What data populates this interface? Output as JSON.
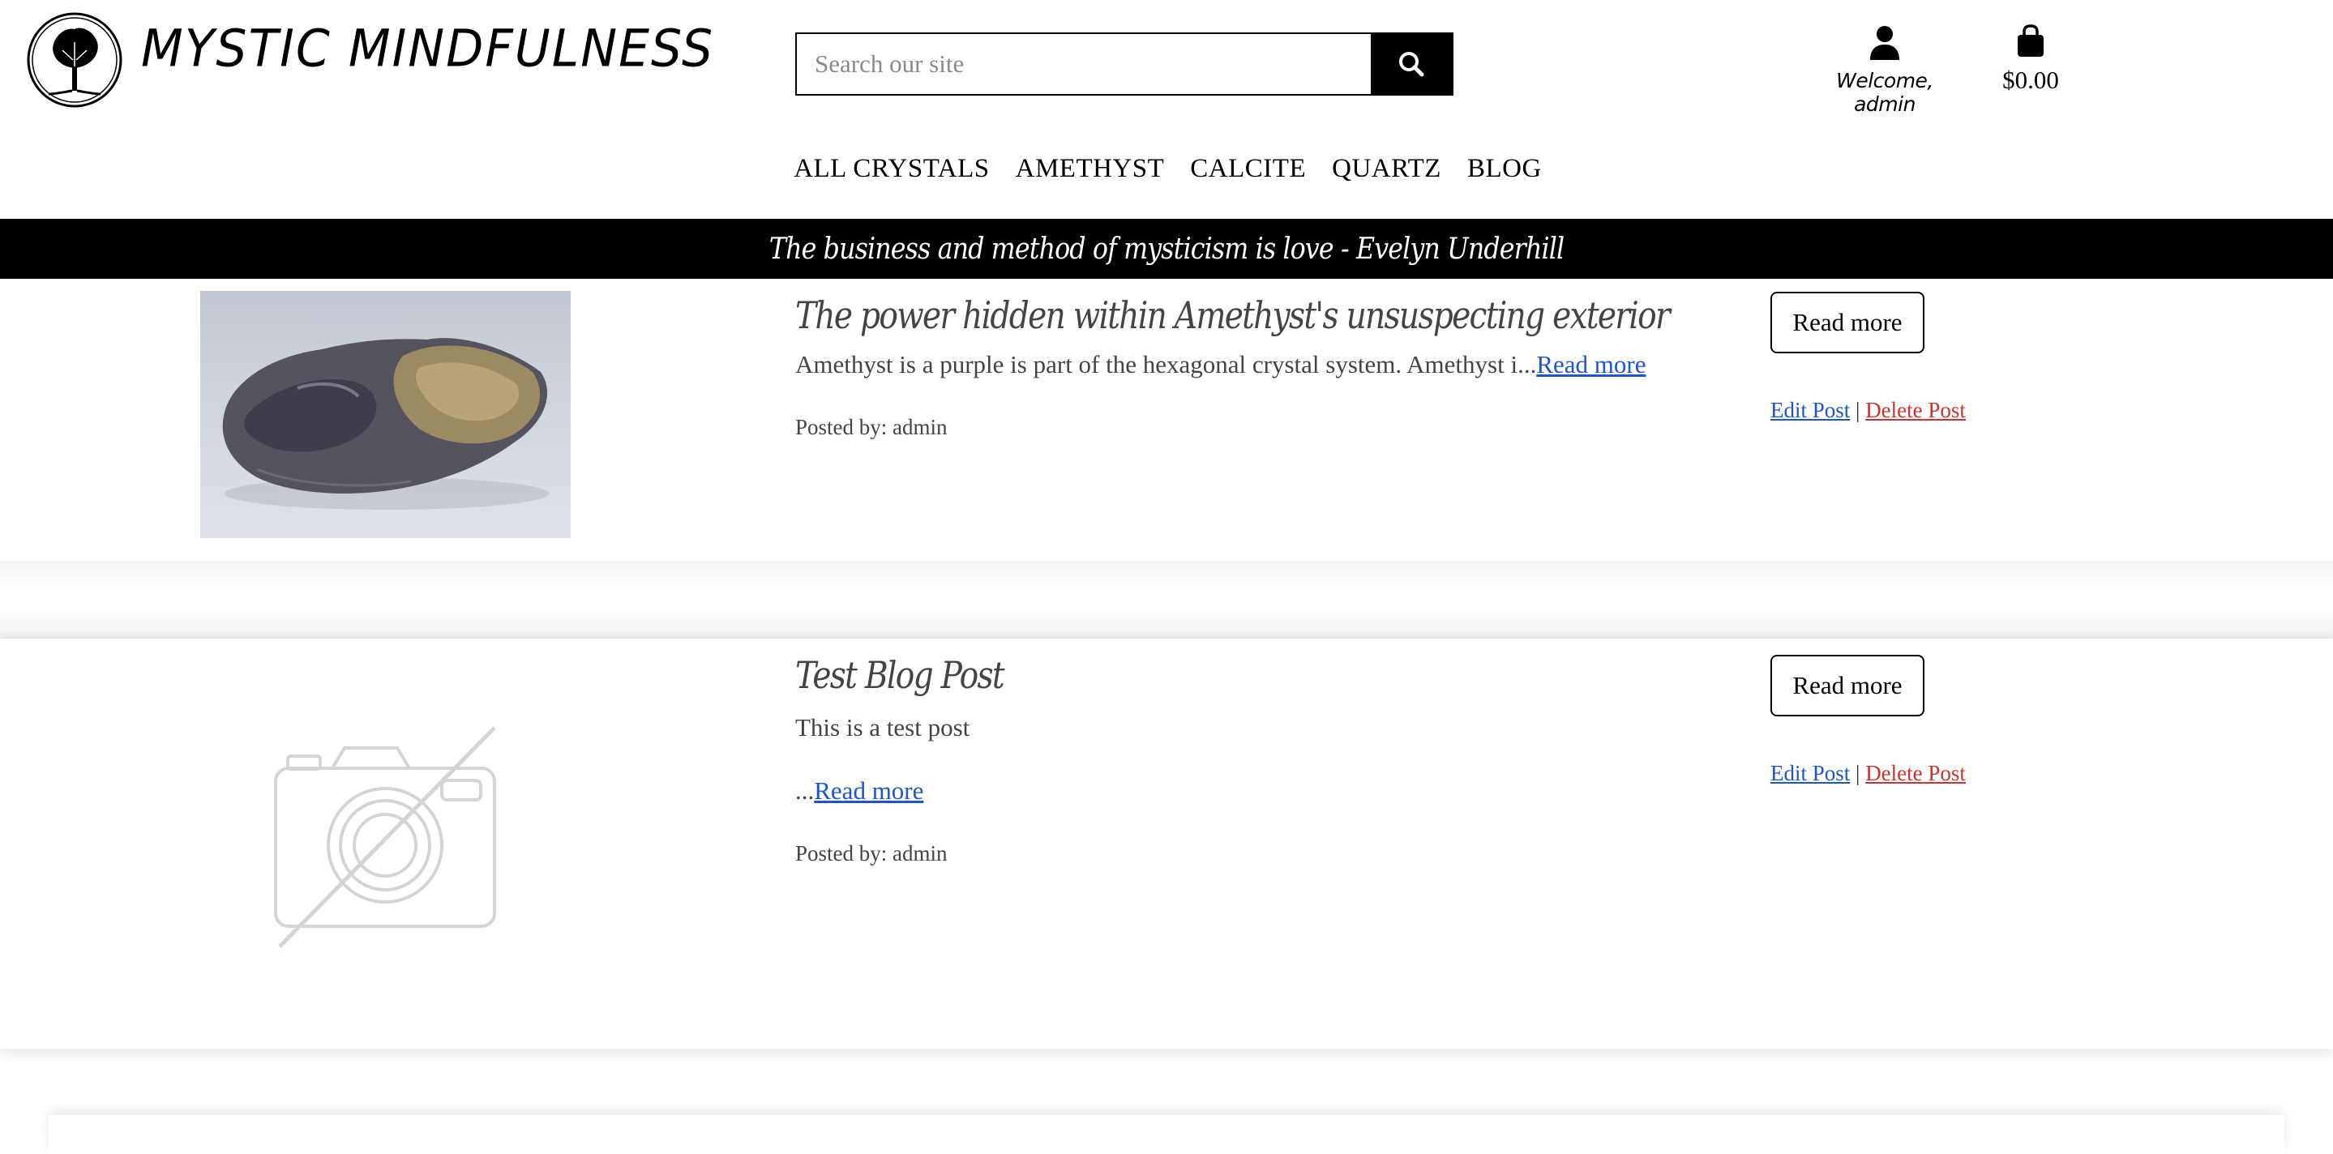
{
  "brand": {
    "name": "MYSTIC MINDFULNESS",
    "logo_icon": "tree-of-life-icon"
  },
  "search": {
    "placeholder": "Search our site",
    "icon": "search-icon"
  },
  "account": {
    "label": "Welcome, admin",
    "icon": "user-icon"
  },
  "bag": {
    "total": "$0.00",
    "icon": "shopping-bag-icon"
  },
  "nav": {
    "items": [
      "ALL CRYSTALS",
      "AMETHYST",
      "CALCITE",
      "QUARTZ",
      "BLOG"
    ]
  },
  "banner": {
    "quote": "The business and method of mysticism is love - Evelyn Underhill"
  },
  "posts": [
    {
      "title": "The power hidden within Amethyst's unsuspecting exterior",
      "excerpt": "Amethyst is a purple is part of the hexagonal crystal system. Amethyst i...",
      "read_more_link": "Read more",
      "posted_by": "Posted by: admin",
      "read_more_button": "Read more",
      "edit": "Edit Post",
      "separator": "|",
      "delete": "Delete Post"
    },
    {
      "title": "Test Blog Post",
      "excerpt": "This is a test post",
      "ellipsis": "...",
      "read_more_link": "Read more",
      "posted_by": "Posted by: admin",
      "read_more_button": "Read more",
      "edit": "Edit Post",
      "separator": "|",
      "delete": "Delete Post",
      "image_icon": "no-image-camera-icon"
    }
  ],
  "colors": {
    "link": "#1a55d6",
    "delete": "#d0312d",
    "banner_bg": "#000000"
  }
}
